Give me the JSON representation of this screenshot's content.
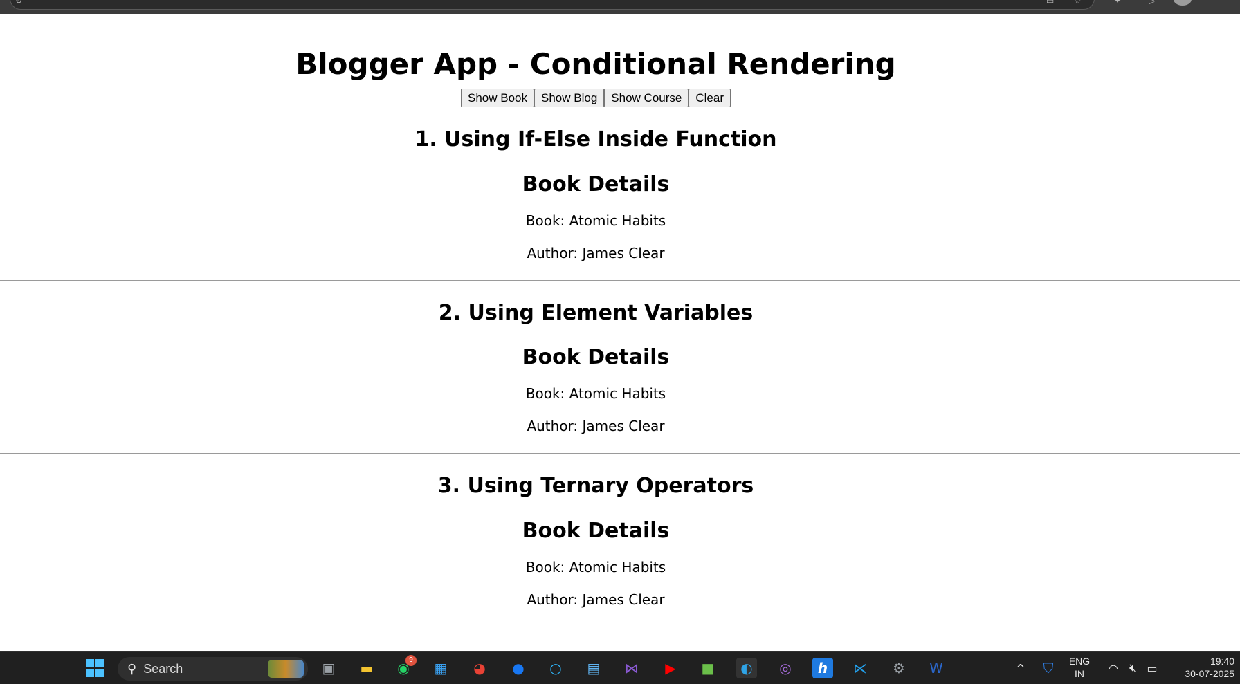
{
  "app": {
    "title": "Blogger App - Conditional Rendering",
    "buttons": [
      "Show Book",
      "Show Blog",
      "Show Course",
      "Clear"
    ]
  },
  "sections": [
    {
      "heading": "1. Using If-Else Inside Function",
      "subheading": "Book Details",
      "book": "Book: Atomic Habits",
      "author": "Author: James Clear"
    },
    {
      "heading": "2. Using Element Variables",
      "subheading": "Book Details",
      "book": "Book: Atomic Habits",
      "author": "Author: James Clear"
    },
    {
      "heading": "3. Using Ternary Operators",
      "subheading": "Book Details",
      "book": "Book: Atomic Habits",
      "author": "Author: James Clear"
    }
  ],
  "taskbar": {
    "search_placeholder": "Search",
    "whatsapp_badge": "9",
    "language_line1": "ENG",
    "language_line2": "IN",
    "time": "19:40",
    "date": "30-07-2025",
    "icons": [
      "windows-start-icon",
      "search-icon",
      "task-view-icon",
      "file-explorer-icon",
      "whatsapp-icon",
      "microsoft-store-icon",
      "chrome-icon",
      "facebook-icon",
      "cortana-icon",
      "notepad-icon",
      "visual-studio-icon",
      "youtube-icon",
      "minecraft-icon",
      "edge-icon",
      "firefox-icon",
      "hostinger-icon",
      "vscode-icon",
      "settings-icon",
      "word-icon",
      "chevron-up-icon",
      "defender-icon",
      "wifi-icon",
      "mute-icon",
      "battery-icon"
    ]
  },
  "colors": {
    "taskbar_bg": "#202020",
    "browser_bar_bg": "#3b3b3b",
    "divider": "#9a9a9a"
  }
}
